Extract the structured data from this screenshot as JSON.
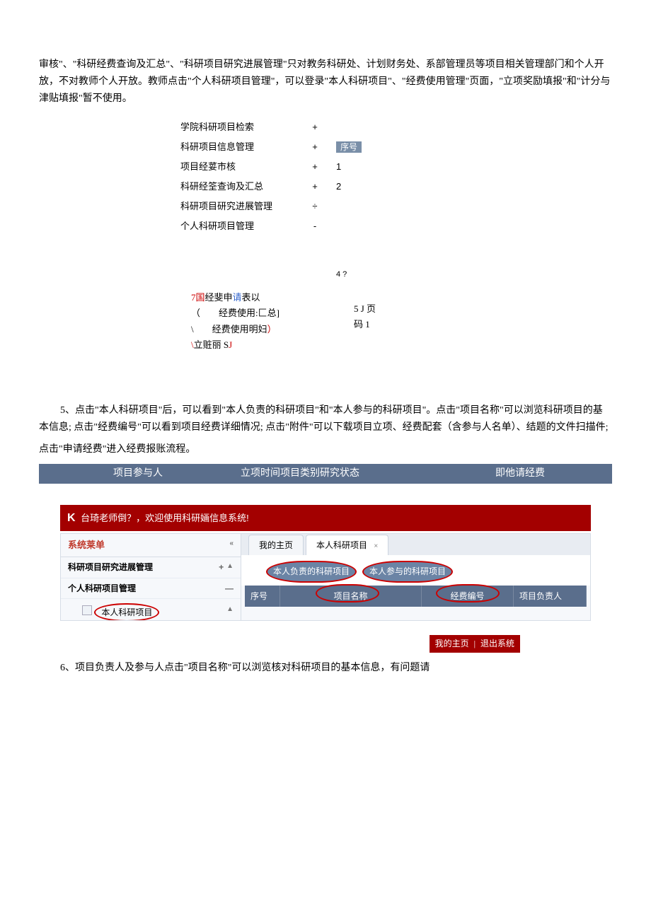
{
  "para1": "审核\"、\"科研经费查询及汇总\"、\"科研项目研究进展管理\"只对教务科研处、计划财务处、系部管理员等项目相关管理部门和个人开放，不对教师个人开放。教师点击\"个人科研项目管理\"，可以登录\"本人科研项目\"、\"经费使用管理\"页面，\"立项奖励填报\"和\"计分与津贴填报\"暂不使用。",
  "menu": [
    {
      "label": "学院科研项目检索",
      "sym": "+",
      "right": ""
    },
    {
      "label": "科研项目信息管理",
      "sym": "+",
      "right_badge": "序号"
    },
    {
      "label": "项目经荽市核",
      "sym": "+",
      "right": "1"
    },
    {
      "label": "科研经筌查询及汇总",
      "sym": "+",
      "right": "2"
    },
    {
      "label": "科研项目研究进展管理",
      "sym": "÷",
      "right": ""
    },
    {
      "label": "个人科研项目管理",
      "sym": "-",
      "right": ""
    }
  ],
  "extra4": "4 ?",
  "sub_lines": {
    "l1_red": "7国",
    "l1_black": "经斐申",
    "l1_blue": "请",
    "l1_tail": "表以",
    "l2": "（        经费使用:匚总]",
    "l3_a": "\\        经费使用明妇",
    "l3_b": "）",
    "l4_a": "\\",
    "l4_b": "立赃丽 S",
    "l4_c": "J",
    "r1": "5 J 页",
    "r2": "码 1"
  },
  "para5": "5、点击\"本人科研项目\"后，可以看到\"本人负责的科研项目\"和\"本人参与的科研项目\"。点击\"项目名称\"可以浏览科研项目的基本信息; 点击\"经费编号\"可以看到项目经费详细情况; 点击\"附件\"可以下载项目立项、经费配套（含参与人名单）、结题的文件扫描件;",
  "para5b": "点击\"申请经费\"进入经费报账流程。",
  "headerbar": {
    "c1": "项目参与人",
    "c2": "立项时间项目类别研究状态",
    "c3": "即他请经费"
  },
  "welcome": {
    "k": "K",
    "text": " 台琦老师倒？，欢迎使用科研婳信息系统!"
  },
  "ui": {
    "sidebar_title": "系统莱单",
    "chevron": "«",
    "sb_item1": "科研项目研究进展管理",
    "sb_item2": "个人科研项目管理",
    "sb_item3": "本人科研项目",
    "plus": "+",
    "minus": "—",
    "up": "▲",
    "tab1": "我的主页",
    "tab2": "本人科研项目",
    "subtab1": "本人负责的科研项目",
    "subtab2": "本人参与的科研项目",
    "th_seq": "序号",
    "th_name": "项目名称",
    "th_code": "经费编号",
    "th_owner": "项目负责人"
  },
  "footer": {
    "link1": "我的主页",
    "link2": "退出系统"
  },
  "para6": "6、项目负责人及参与人点击\"项目名称\"可以浏览核对科研项目的基本信息，有问题请"
}
